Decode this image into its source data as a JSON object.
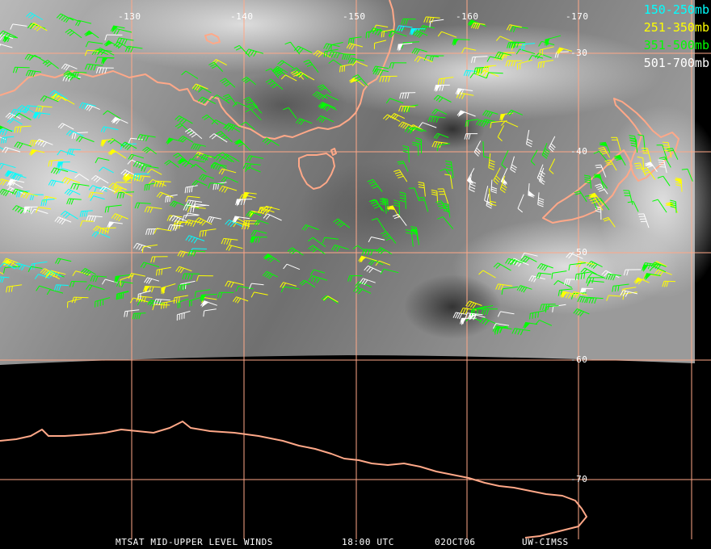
{
  "map": {
    "lon_labels": [
      "-130",
      "-140",
      "-150",
      "-160",
      "-170"
    ],
    "lat_labels": [
      "-30",
      "-40",
      "-50",
      "-60",
      "-70"
    ],
    "grid_color": "#ffa888",
    "coast_color": "#ffa888"
  },
  "legend": [
    {
      "label": "150-250mb",
      "color": "#00ffff"
    },
    {
      "label": "251-350mb",
      "color": "#ffff00"
    },
    {
      "label": "351-500mb",
      "color": "#00ff00"
    },
    {
      "label": "501-700mb",
      "color": "#ffffff"
    }
  ],
  "footer": {
    "title": "MTSAT MID-UPPER LEVEL WINDS",
    "time": "18:00 UTC",
    "date": "02OCT06",
    "credit": "UW-CIMSS"
  }
}
